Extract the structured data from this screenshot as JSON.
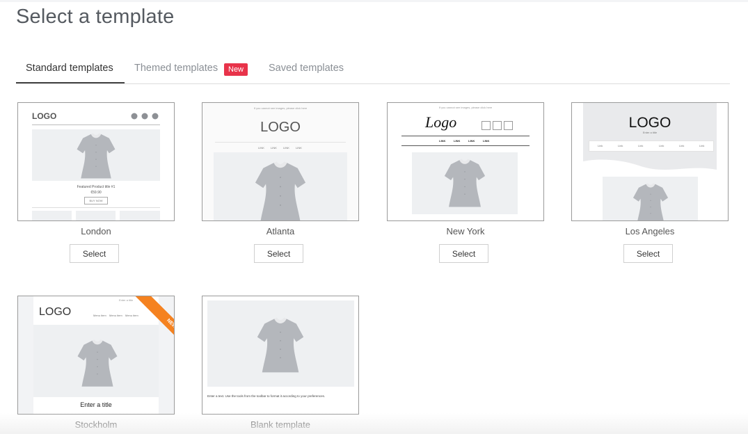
{
  "page": {
    "title": "Select a template"
  },
  "tabs": [
    {
      "label": "Standard templates",
      "active": true
    },
    {
      "label": "Themed templates",
      "badge": "New"
    },
    {
      "label": "Saved templates"
    }
  ],
  "select_label": "Select",
  "templates": [
    {
      "name": "London",
      "logo": "LOGO",
      "product_title": "Featured Product title #1",
      "price": "€59.90",
      "cta": "BUY NOW"
    },
    {
      "name": "Atlanta",
      "header_note": "If you cannot see images, please click here",
      "logo": "LOGO",
      "links": [
        "LINK",
        "LINK",
        "LINK",
        "LINK"
      ]
    },
    {
      "name": "New York",
      "header_note": "If you cannot see images, please click here",
      "logo": "Logo",
      "links": [
        "LINK",
        "LINK",
        "LINK",
        "LINK"
      ]
    },
    {
      "name": "Los Angeles",
      "logo": "LOGO",
      "subtitle": "Enter a title",
      "links": [
        "Link",
        "Link",
        "Link",
        "Link",
        "Link",
        "Link"
      ]
    },
    {
      "name": "Stockholm",
      "logo": "LOGO",
      "header_note": "Enter a title",
      "links": [
        "Menu item",
        "Menu item",
        "Menu item"
      ],
      "ribbon": "NEW",
      "title_text": "Enter a title"
    },
    {
      "name": "Blank template",
      "body_text": "Enter a text. Use the tools from the toolbar to format it according to your preferences."
    }
  ],
  "colors": {
    "accent_badge": "#e8334a",
    "ribbon": "#f58220",
    "placeholder": "#eef0f2",
    "shirt": "#b4b7bc"
  },
  "icons": [
    "twitter-icon",
    "googleplus-icon",
    "facebook-icon",
    "instagram-icon",
    "shirt-icon"
  ]
}
